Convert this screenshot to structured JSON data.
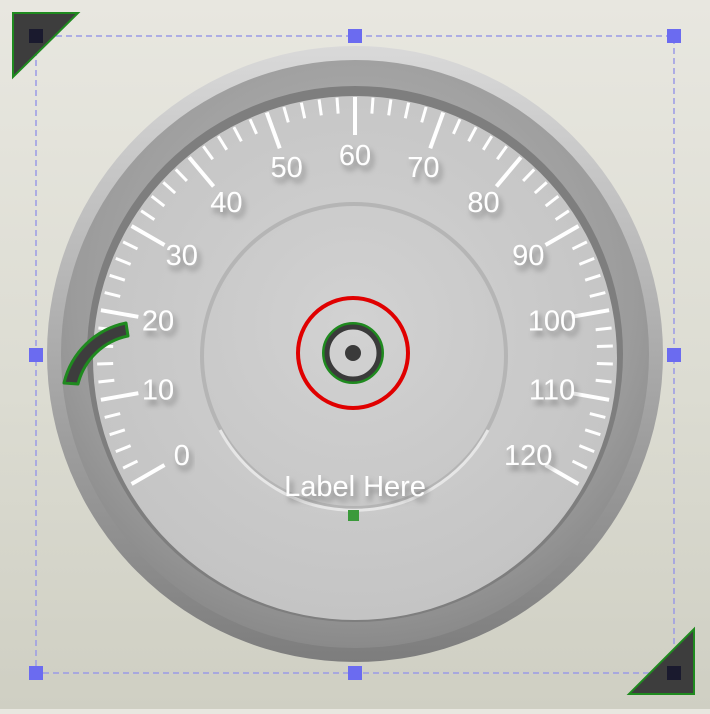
{
  "gauge": {
    "scale_labels": [
      "0",
      "10",
      "20",
      "30",
      "40",
      "50",
      "60",
      "70",
      "80",
      "90",
      "100",
      "110",
      "120"
    ],
    "min": 0,
    "max": 120,
    "caption": "Label Here"
  },
  "colors": {
    "selection_handle": "#6b6bf0",
    "selection_border": "#9a9ae6",
    "needle_ring": "#e00000",
    "accent_green": "#1f8a1f",
    "corner_marker": "#3a3a3a",
    "tick_color": "#ffffff"
  },
  "icons": {
    "corner_top_left": "corner-triangle-icon",
    "corner_bottom_right": "corner-triangle-icon",
    "rotate_handle": "rotate-arc-icon",
    "pivot": "pivot-target-icon"
  }
}
